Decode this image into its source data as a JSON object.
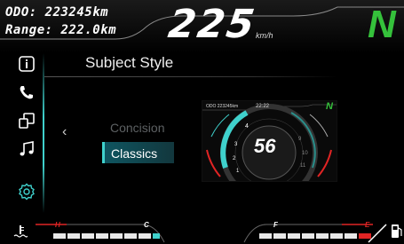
{
  "header": {
    "odo": "ODO: 223245km",
    "range": "Range: 222.0km",
    "speed": "225",
    "speed_unit": "km/h",
    "gear": "N"
  },
  "sidebar": {
    "items": [
      {
        "icon": "info-icon"
      },
      {
        "icon": "phone-icon"
      },
      {
        "icon": "screen-mirror-icon"
      },
      {
        "icon": "music-icon"
      },
      {
        "icon": "settings-icon",
        "active": true
      }
    ]
  },
  "main": {
    "title": "Subject Style",
    "back_symbol": "‹",
    "options": [
      {
        "label": "Concision",
        "selected": false
      },
      {
        "label": "Classics",
        "selected": true
      }
    ]
  },
  "preview": {
    "odo": "ODO 223245km",
    "time": "22:22",
    "gear": "N",
    "speed": "56",
    "unit": "km/h"
  },
  "bottom": {
    "temp_hot": "H",
    "temp_cold": "C",
    "fuel_full": "F",
    "fuel_empty": "E"
  },
  "colors": {
    "accent": "#3fd1cc",
    "gear_green": "#35c13b",
    "warning_red": "#e02424"
  }
}
